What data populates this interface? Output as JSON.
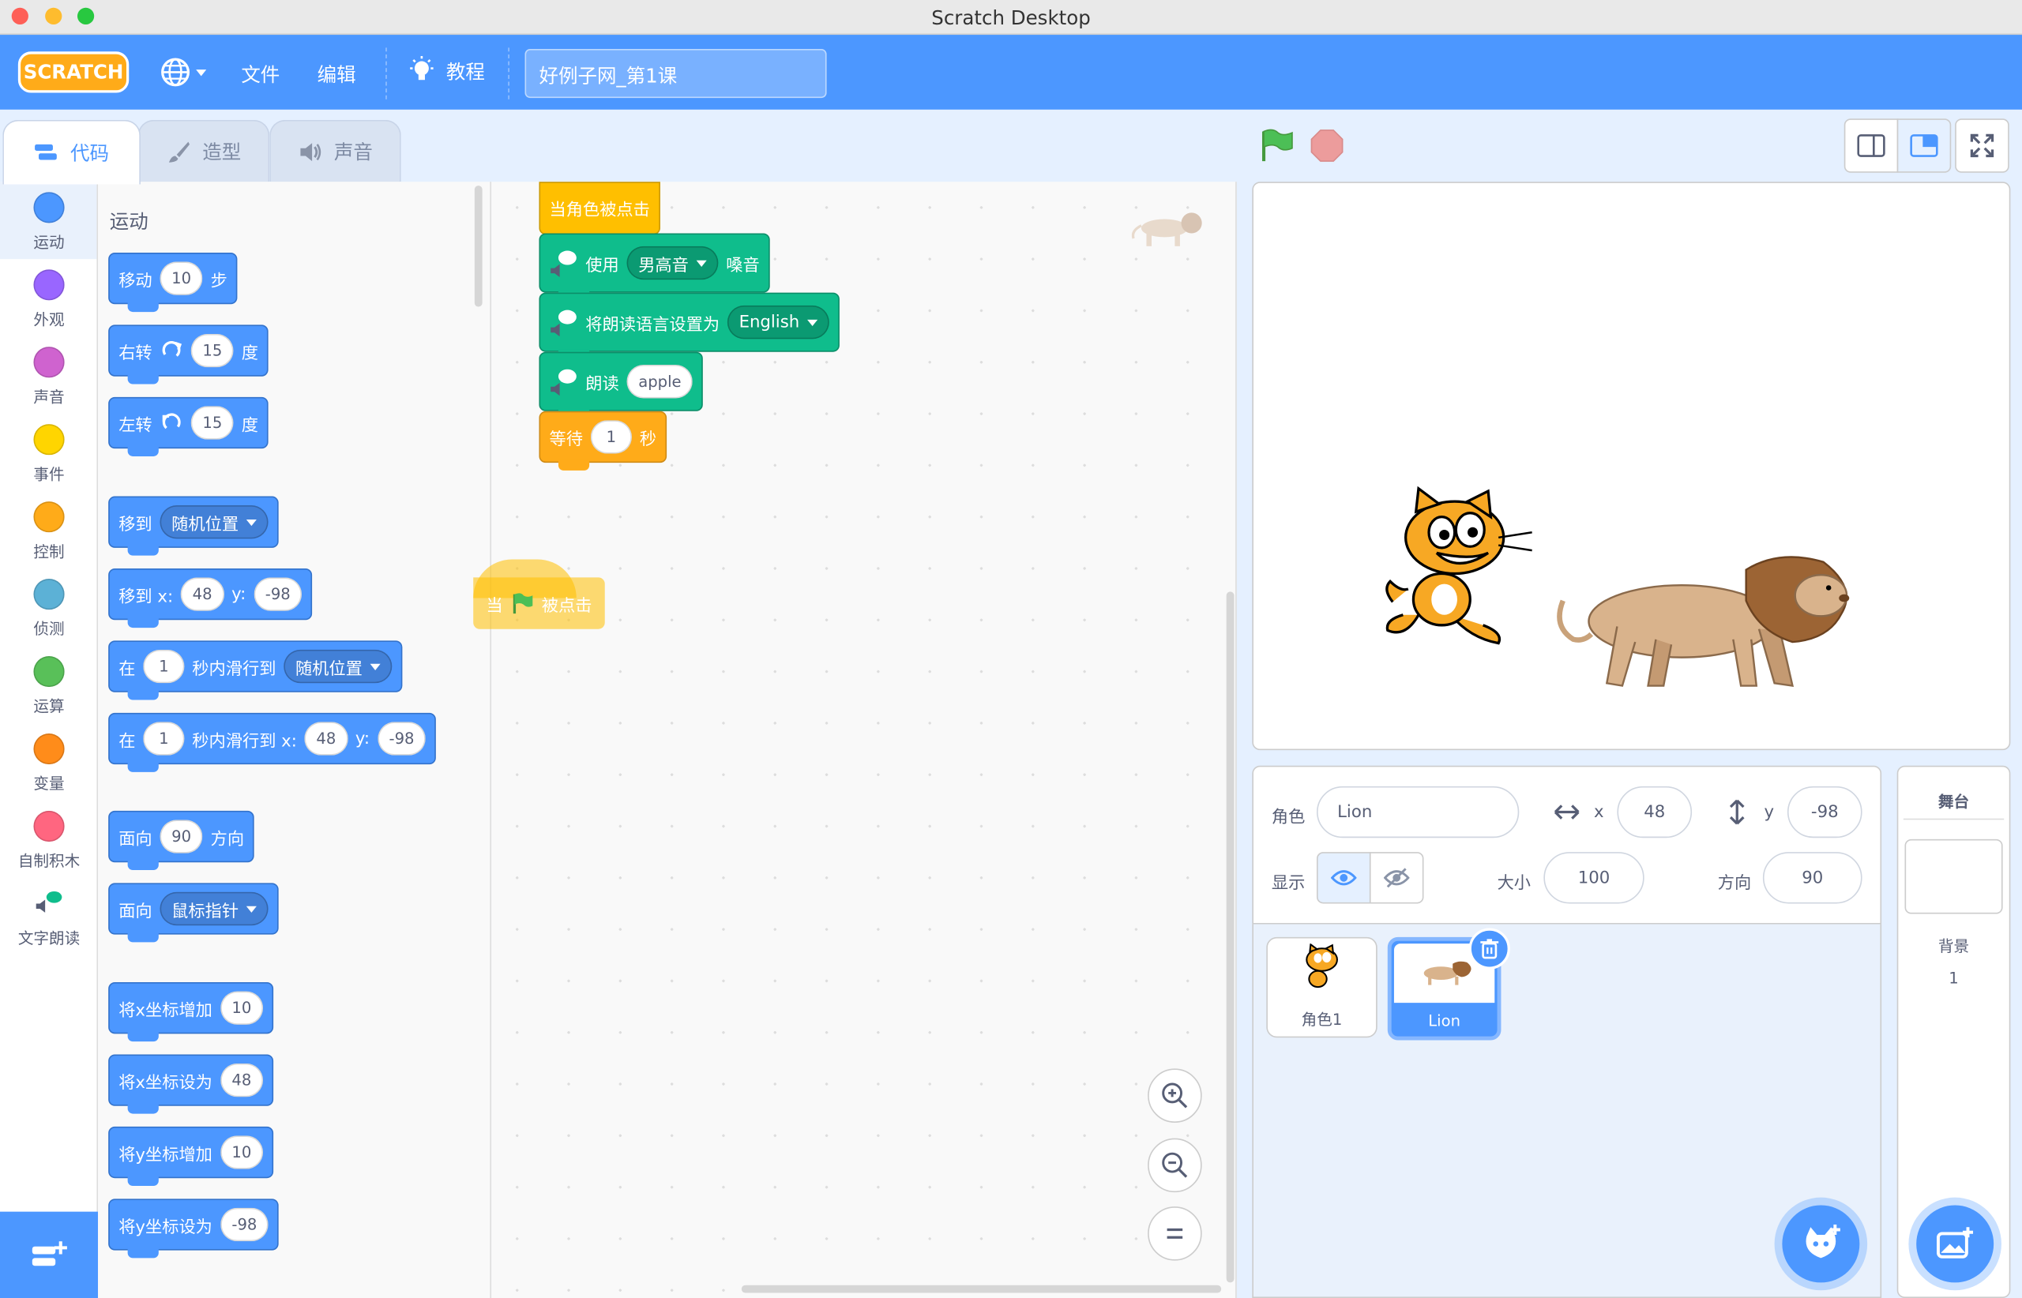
{
  "window": {
    "title": "Scratch Desktop"
  },
  "menu": {
    "logo": "SCRATCH",
    "file": "文件",
    "edit": "编辑",
    "tutorials": "教程",
    "project_title": "好例子网_第1课"
  },
  "tabs": {
    "code": "代码",
    "costumes": "造型",
    "sounds": "声音"
  },
  "categories": [
    {
      "label": "运动",
      "color": "#4c97ff"
    },
    {
      "label": "外观",
      "color": "#9966ff"
    },
    {
      "label": "声音",
      "color": "#cf63cf"
    },
    {
      "label": "事件",
      "color": "#ffd500"
    },
    {
      "label": "控制",
      "color": "#ffab19"
    },
    {
      "label": "侦测",
      "color": "#5cb1d6"
    },
    {
      "label": "运算",
      "color": "#59c059"
    },
    {
      "label": "变量",
      "color": "#ff8c1a"
    },
    {
      "label": "自制积木",
      "color": "#ff6680"
    },
    {
      "label": "文字朗读",
      "color": "#0fbd8c"
    }
  ],
  "palette": {
    "heading": "运动",
    "move": {
      "a": "移动",
      "v": "10",
      "b": "步"
    },
    "turn_right": {
      "a": "右转",
      "v": "15",
      "b": "度"
    },
    "turn_left": {
      "a": "左转",
      "v": "15",
      "b": "度"
    },
    "goto": {
      "a": "移到",
      "dd": "随机位置"
    },
    "goto_xy": {
      "a": "移到 x:",
      "x": "48",
      "yl": "y:",
      "y": "-98"
    },
    "glide": {
      "a": "在",
      "v": "1",
      "b": "秒内滑行到",
      "dd": "随机位置"
    },
    "glide_xy": {
      "a": "在",
      "v": "1",
      "b": "秒内滑行到 x:",
      "x": "48",
      "yl": "y:",
      "y": "-98"
    },
    "point_dir": {
      "a": "面向",
      "v": "90",
      "b": "方向"
    },
    "point_towards": {
      "a": "面向",
      "dd": "鼠标指针"
    },
    "change_x": {
      "a": "将x坐标增加",
      "v": "10"
    },
    "set_x": {
      "a": "将x坐标设为",
      "v": "48"
    },
    "change_y": {
      "a": "将y坐标增加",
      "v": "10"
    },
    "set_y": {
      "a": "将y坐标设为",
      "v": "-98"
    }
  },
  "script": {
    "hat": "当角色被点击",
    "voice": {
      "a": "使用",
      "dd": "男高音",
      "b": "嗓音"
    },
    "lang": {
      "a": "将朗读语言设置为",
      "dd": "English"
    },
    "speak": {
      "a": "朗读",
      "v": "apple"
    },
    "wait": {
      "a": "等待",
      "v": "1",
      "b": "秒"
    },
    "flag_hat": {
      "a": "当",
      "b": "被点击"
    }
  },
  "sprite_info": {
    "sprite_label": "角色",
    "sprite_name": "Lion",
    "x_label": "x",
    "x": "48",
    "y_label": "y",
    "y": "-98",
    "show_label": "显示",
    "size_label": "大小",
    "size": "100",
    "direction_label": "方向",
    "direction": "90"
  },
  "sprites": [
    {
      "name": "角色1"
    },
    {
      "name": "Lion"
    }
  ],
  "stage_pane": {
    "title": "舞台",
    "backdrop_label": "背景",
    "backdrop_count": "1"
  }
}
